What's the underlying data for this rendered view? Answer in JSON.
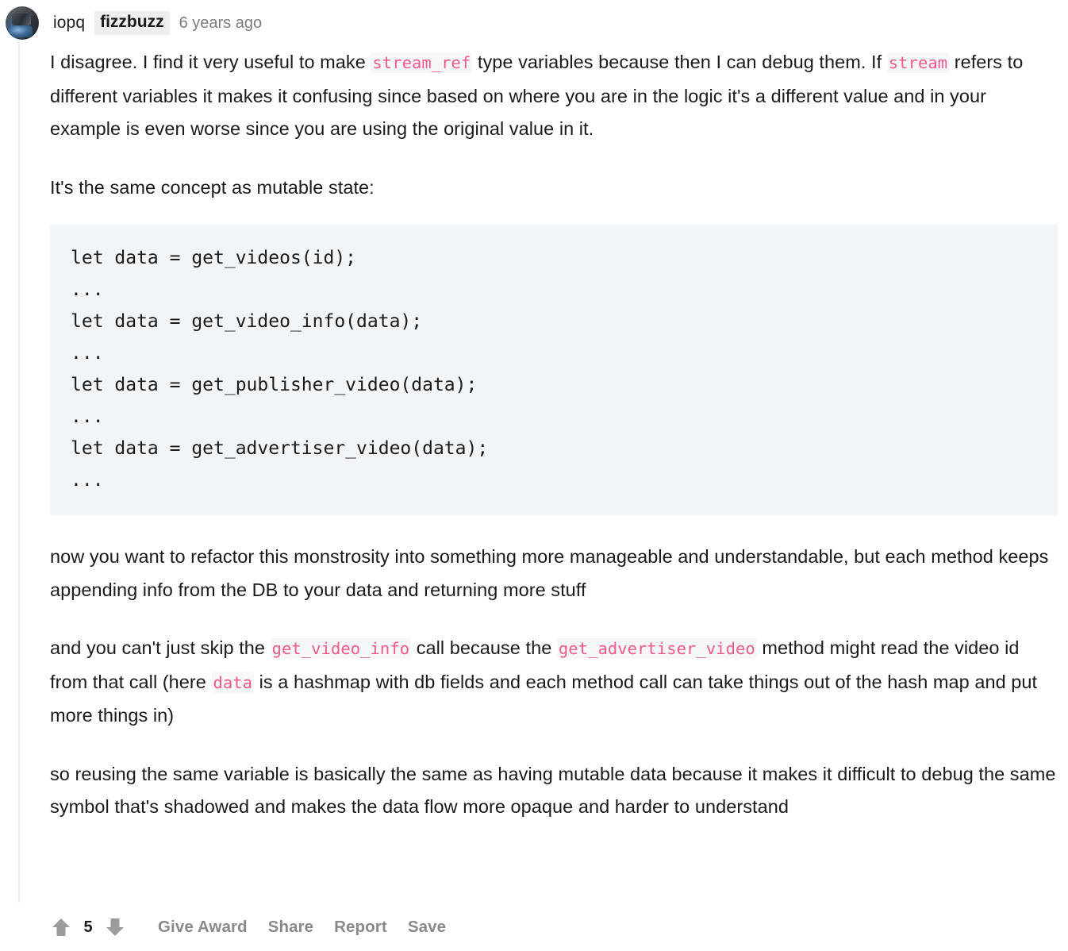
{
  "comment": {
    "author": "iopq",
    "flair": "fizzbuzz",
    "timestamp": "6 years ago",
    "avatar_icon": "user-avatar-image",
    "paragraphs": {
      "p1_a": "I disagree. I find it very useful to make ",
      "p1_code1": "stream_ref",
      "p1_b": " type variables because then I can debug them. If ",
      "p1_code2": "stream",
      "p1_c": " refers to different variables it makes it confusing since based on where you are in the logic it's a different value and in your example is even worse since you are using the original value in it.",
      "p2": "It's the same concept as mutable state:",
      "p3": "now you want to refactor this monstrosity into something more manageable and understandable, but each method keeps appending info from the DB to your data and returning more stuff",
      "p4_a": "and you can't just skip the ",
      "p4_code1": "get_video_info",
      "p4_b": " call because the ",
      "p4_code2": "get_advertiser_video",
      "p4_c": " method might read the video id from that call (here ",
      "p4_code3": "data",
      "p4_d": " is a hashmap with db fields and each method call can take things out of the hash map and put more things in)",
      "p5": "so reusing the same variable is basically the same as having mutable data because it makes it difficult to debug the same symbol that's shadowed and makes the data flow more opaque and harder to understand"
    },
    "code_block": [
      "let data = get_videos(id);",
      "...",
      "let data = get_video_info(data);",
      "...",
      "let data = get_publisher_video(data);",
      "...",
      "let data = get_advertiser_video(data);",
      "..."
    ],
    "actions": {
      "upvote_icon": "upvote-arrow-icon",
      "score": "5",
      "downvote_icon": "downvote-arrow-icon",
      "give_award": "Give Award",
      "share": "Share",
      "report": "Report",
      "save": "Save"
    }
  },
  "colors": {
    "inline_code": "#ef5a87",
    "code_block_bg": "#f2f5f8",
    "flair_bg": "#eceef0",
    "action_text": "#878a8c",
    "thread_line": "#edeff1",
    "body_text": "#1a1a1b"
  }
}
